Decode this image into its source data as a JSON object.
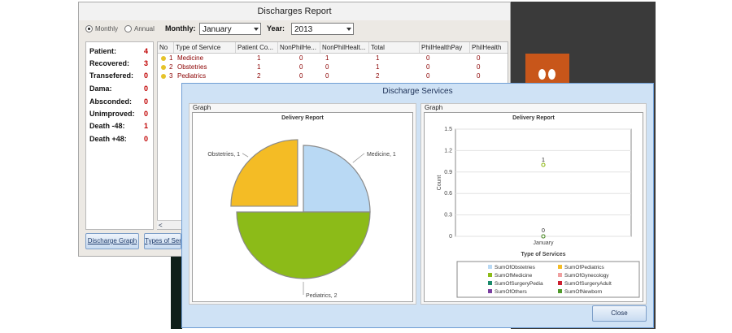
{
  "report_window": {
    "title": "Discharges Report",
    "period_options": [
      {
        "label": "Monthly",
        "selected": true
      },
      {
        "label": "Annual",
        "selected": false
      }
    ],
    "monthly_label": "Monthly:",
    "monthly_value": "January",
    "year_label": "Year:",
    "year_value": "2013",
    "stats": [
      {
        "label": "Patient:",
        "value": "4"
      },
      {
        "label": "Recovered:",
        "value": "3"
      },
      {
        "label": "Transefered:",
        "value": "0"
      },
      {
        "label": "Dama:",
        "value": "0"
      },
      {
        "label": "Absconded:",
        "value": "0"
      },
      {
        "label": "Unimproved:",
        "value": "0"
      },
      {
        "label": "Death -48:",
        "value": "1"
      },
      {
        "label": "Death +48:",
        "value": "0"
      }
    ],
    "table": {
      "columns": [
        "No",
        "Type of Service",
        "Patient Co...",
        "NonPhilHe...",
        "NonPhilHealt...",
        "Total",
        "PhilHealthPay",
        "PhilHealth"
      ],
      "rows": [
        [
          "1",
          "Medicine",
          "1",
          "0",
          "1",
          "1",
          "0",
          "0"
        ],
        [
          "2",
          "Obstetries",
          "1",
          "0",
          "0",
          "1",
          "0",
          "0"
        ],
        [
          "3",
          "Pediatrics",
          "2",
          "0",
          "0",
          "2",
          "0",
          "0"
        ]
      ],
      "scroll_left": "<"
    },
    "buttons": {
      "discharge_graph": "Discharge Graph",
      "types_of_service": "Types of Serv"
    }
  },
  "services_window": {
    "title": "Discharge Services",
    "left_group_label": "Graph",
    "right_group_label": "Graph",
    "close_label": "Close"
  },
  "chart_data": [
    {
      "type": "pie",
      "title": "Delivery Report",
      "slices": [
        {
          "label": "Medicine, 1",
          "value": 1,
          "color": "#b9d9f4"
        },
        {
          "label": "Pediatrics, 2",
          "value": 2,
          "color": "#8cbb18"
        },
        {
          "label": "Obstetries, 1",
          "value": 1,
          "color": "#f4bc25"
        }
      ],
      "exploded": "Obstetries, 1"
    },
    {
      "type": "line",
      "title": "Delivery Report",
      "xlabel": "Type of Services",
      "ylabel": "Count",
      "categories": [
        "January"
      ],
      "ylim": [
        0,
        1.5
      ],
      "yticks": [
        "0",
        "0.3",
        "0.6",
        "0.9",
        "1.2",
        "1.5"
      ],
      "series": [
        {
          "name": "SumOfObstetries",
          "values": [
            1
          ],
          "color": "#b9d9f4"
        },
        {
          "name": "SumOfPediatrics",
          "values": [
            1
          ],
          "color": "#f4bc25"
        },
        {
          "name": "SumOfMedicine",
          "values": [
            1
          ],
          "color": "#8cbb18"
        },
        {
          "name": "SumOfGynecology",
          "values": [
            0
          ],
          "color": "#f0a0a0"
        },
        {
          "name": "SumOfSurgeryPedia",
          "values": [
            0
          ],
          "color": "#1b8a6b"
        },
        {
          "name": "SumOfSurgeryAdult",
          "values": [
            0
          ],
          "color": "#cc1f2f"
        },
        {
          "name": "SumOfOthers",
          "values": [
            0
          ],
          "color": "#7a3ea0"
        },
        {
          "name": "SumOfNewborn",
          "values": [
            0
          ],
          "color": "#4f9a2a"
        }
      ],
      "point_labels": [
        "1",
        "0"
      ],
      "legend_position": "bottom"
    }
  ]
}
